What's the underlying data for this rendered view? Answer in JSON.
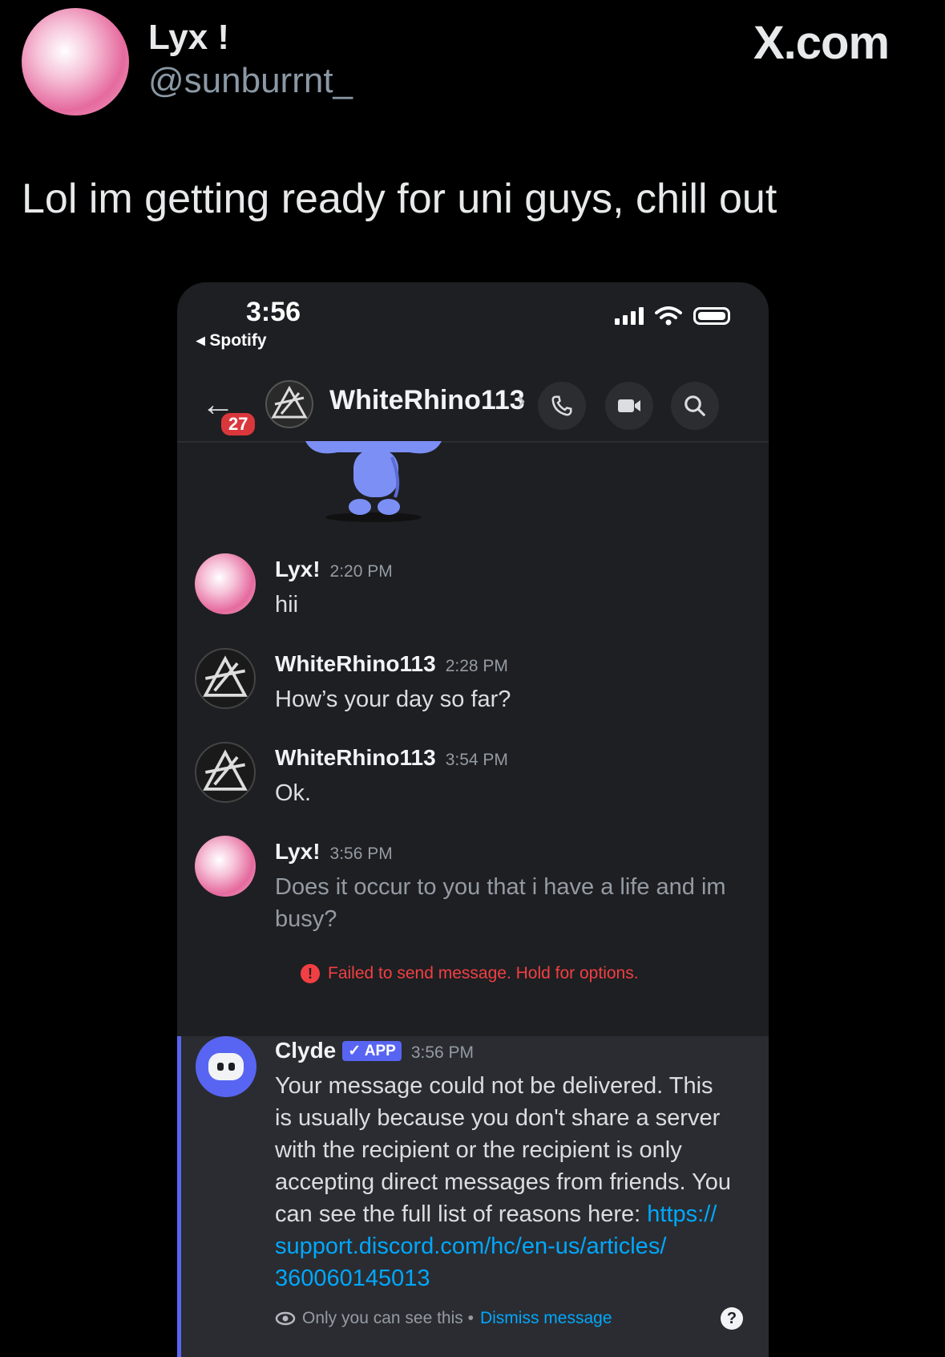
{
  "tweet": {
    "display_name": "Lyx !",
    "handle": "@sunburrnt_",
    "brand": "X.com",
    "text": "Lol im getting ready for uni guys, chill out"
  },
  "phone": {
    "status_time": "3:56",
    "back_app": "◂ Spotify"
  },
  "chat_header": {
    "unread_badge": "27",
    "title": "WhiteRhino113",
    "chevron": "›",
    "icons": [
      "back-arrow-icon",
      "phone-icon",
      "video-icon",
      "search-icon"
    ]
  },
  "messages": [
    {
      "author": "Lyx!",
      "time": "2:20 PM",
      "text": "hii"
    },
    {
      "author": "WhiteRhino113",
      "time": "2:28 PM",
      "text": "How’s your day so far?"
    },
    {
      "author": "WhiteRhino113",
      "time": "3:54 PM",
      "text": "Ok."
    },
    {
      "author": "Lyx!",
      "time": "3:56 PM",
      "text": "Does it occur to you that i have a life and im busy?"
    }
  ],
  "failed_notice": "Failed to send message. Hold for options.",
  "clyde": {
    "author": "Clyde",
    "tag": "✓ APP",
    "time": "3:56 PM",
    "text": "Your message could not be delivered. This is usually because you don't share a server with the recipient or the recipient is only accepting direct messages from friends. You can see the full list of reasons here: ",
    "link": "https:// support.discord.com/hc/en-us/articles/ 360060145013",
    "ephemeral_text": "Only you can see this •",
    "dismiss_label": "Dismiss message",
    "help": "?"
  },
  "colors": {
    "background": "#000000",
    "discord_bg": "#1e1f22",
    "blurple": "#5865f2",
    "error": "#f23f43",
    "link": "#00a8fc"
  }
}
